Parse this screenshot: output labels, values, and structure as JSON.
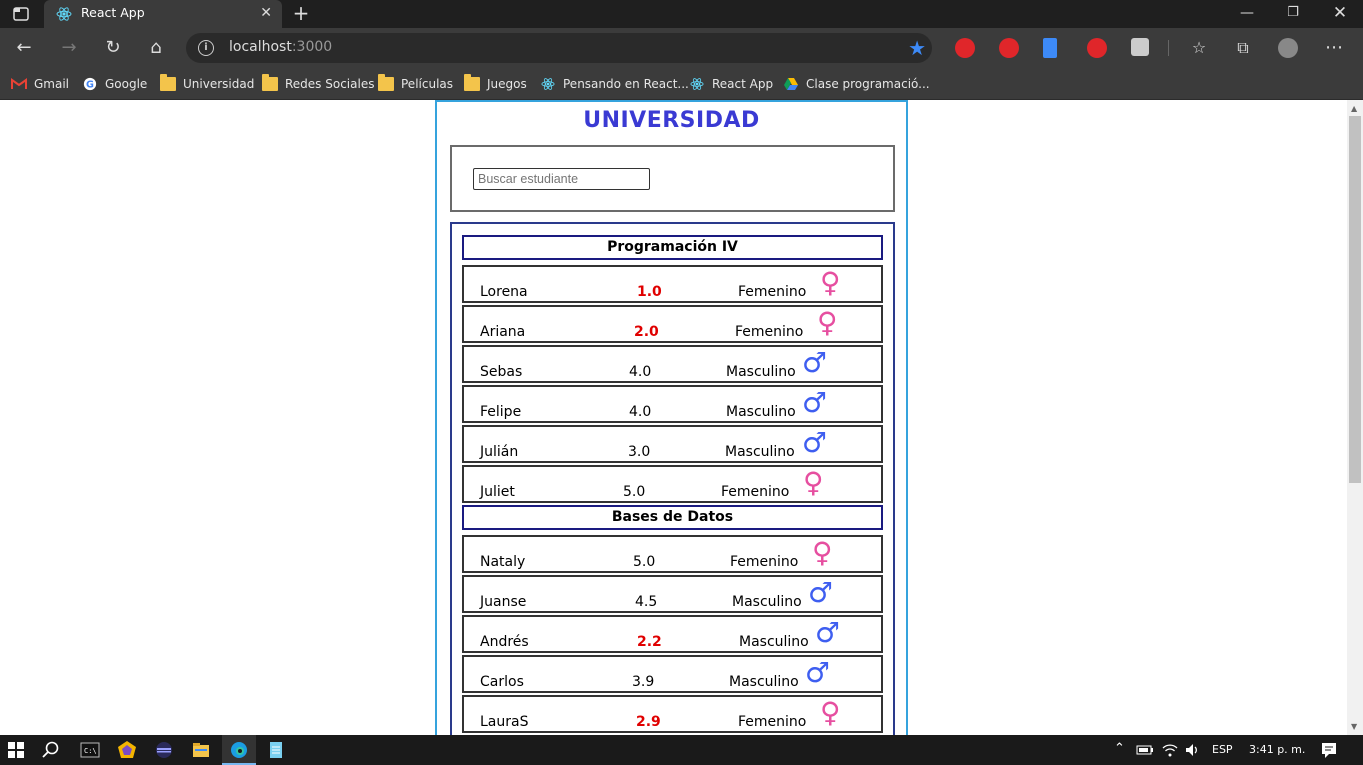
{
  "browser": {
    "tab_title": "React App",
    "tab_close": "✕",
    "new_tab": "+",
    "url_host": "localhost",
    "url_port": ":3000",
    "window_controls": {
      "minimize": "—",
      "maximize": "❐",
      "close": "✕"
    },
    "nav": {
      "back": "←",
      "forward": "→",
      "reload": "↻",
      "home": "⌂",
      "favorites_star": "★",
      "settings_more": "⋯"
    }
  },
  "bookmarks": [
    {
      "label": "Gmail",
      "icon": "gmail-icon"
    },
    {
      "label": "Google",
      "icon": "google-icon"
    },
    {
      "label": "Universidad",
      "icon": "folder-icon"
    },
    {
      "label": "Redes Sociales",
      "icon": "folder-icon"
    },
    {
      "label": "Películas",
      "icon": "folder-icon"
    },
    {
      "label": "Juegos",
      "icon": "folder-icon"
    },
    {
      "label": "Pensando en React...",
      "icon": "react-icon"
    },
    {
      "label": "React App",
      "icon": "react-icon"
    },
    {
      "label": "Clase programació...",
      "icon": "drive-icon"
    }
  ],
  "app": {
    "title": "UNIVERSIDAD",
    "search_placeholder": "Buscar estudiante",
    "courses": [
      {
        "name": "Programación IV",
        "students": [
          {
            "name": "Lorena",
            "grade": "1.0",
            "gender": "Femenino",
            "failing": true
          },
          {
            "name": "Ariana",
            "grade": "2.0",
            "gender": "Femenino",
            "failing": true
          },
          {
            "name": "Sebas",
            "grade": "4.0",
            "gender": "Masculino",
            "failing": false
          },
          {
            "name": "Felipe",
            "grade": "4.0",
            "gender": "Masculino",
            "failing": false
          },
          {
            "name": "Julián",
            "grade": "3.0",
            "gender": "Masculino",
            "failing": false
          },
          {
            "name": "Juliet",
            "grade": "5.0",
            "gender": "Femenino",
            "failing": false
          }
        ]
      },
      {
        "name": "Bases de Datos",
        "students": [
          {
            "name": "Nataly",
            "grade": "5.0",
            "gender": "Femenino",
            "failing": false
          },
          {
            "name": "Juanse",
            "grade": "4.5",
            "gender": "Masculino",
            "failing": false
          },
          {
            "name": "Andrés",
            "grade": "2.2",
            "gender": "Masculino",
            "failing": true
          },
          {
            "name": "Carlos",
            "grade": "3.9",
            "gender": "Masculino",
            "failing": false
          },
          {
            "name": "LauraS",
            "grade": "2.9",
            "gender": "Femenino",
            "failing": true
          }
        ]
      }
    ],
    "symbols": {
      "female": "♀",
      "male": "♂"
    },
    "colors": {
      "failing_grade": "#e00000",
      "female": "#e64fa0",
      "male": "#3e5ef0",
      "title": "#3a3ad3"
    }
  },
  "taskbar": {
    "language": "ESP",
    "time": "3:41 p. m."
  }
}
